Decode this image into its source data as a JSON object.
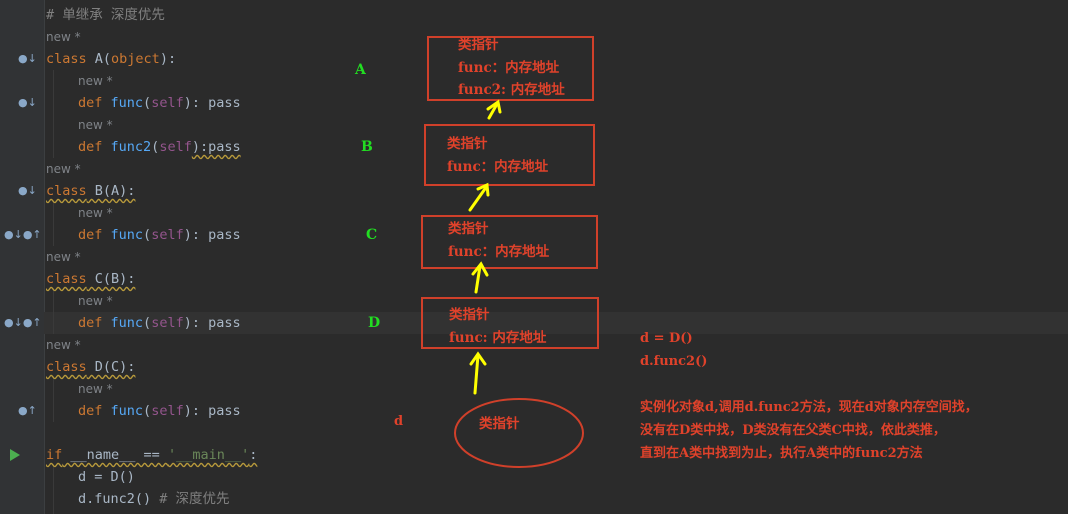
{
  "editor": {
    "comment_top": "# 单继承 深度优先",
    "hint": "new *",
    "code": {
      "class_a": "class",
      "class_a_name": " A(",
      "class_a_object": "object",
      "class_a_end": "):",
      "def": "def",
      "func": "func",
      "func2": "func2",
      "self": "self",
      "pass": "): pass",
      "pass2": "):pass",
      "class_b": " B(A):",
      "class_c": " C(B):",
      "class_d": " D(C):",
      "if_kw": "if",
      "main_name": " __name__ == ",
      "main_str": "'__main__'",
      "main_end": ":",
      "assign": "d = D()",
      "call": "d.func2()",
      "call_comment": " # 深度优先"
    }
  },
  "diagram": {
    "box_a": {
      "title": "类指针",
      "line1": "func：内存地址",
      "line2": "func2: 内存地址"
    },
    "box_b": {
      "title": "类指针",
      "line1": "func：内存地址"
    },
    "box_c": {
      "title": "类指针",
      "line1": "func：内存地址"
    },
    "box_d": {
      "title": "类指针",
      "line1": "func: 内存地址"
    },
    "instance": {
      "title": "类指针",
      "label": "d"
    },
    "labels": {
      "a": "A",
      "b": "B",
      "c": "C",
      "d": "D"
    },
    "notes": {
      "line1": "d = D()",
      "line2": "d.func2()",
      "line3": "实例化对象d,调用d.func2方法，现在d对象内存空间找，",
      "line4": "没有在D类中找，D类没有在父类C中找，依此类推，",
      "line5": "直到在A类中找到为止，执行A类中的func2方法"
    },
    "colors": {
      "box": "#d0402a",
      "arrow": "#ffff00",
      "label": "#22dd22"
    }
  }
}
